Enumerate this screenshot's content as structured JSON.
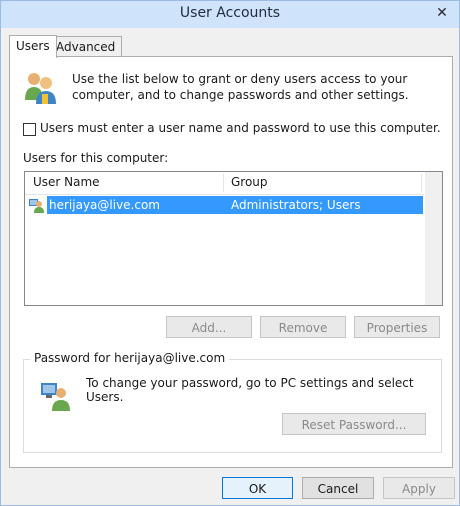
{
  "window": {
    "title": "User Accounts",
    "close_glyph": "✕"
  },
  "tabs": [
    {
      "label": "Users",
      "active": true
    },
    {
      "label": "Advanced",
      "active": false
    }
  ],
  "intro": {
    "icon": "users-icon",
    "text": "Use the list below to grant or deny users access to your computer, and to change passwords and other settings."
  },
  "require_login": {
    "label": "Users must enter a user name and password to use this computer.",
    "checked": false
  },
  "users_list": {
    "label": "Users for this computer:",
    "columns": [
      "User Name",
      "Group"
    ],
    "rows": [
      {
        "user": "herijaya@live.com",
        "group": "Administrators; Users",
        "selected": true
      }
    ]
  },
  "list_buttons": {
    "add": "Add...",
    "remove": "Remove",
    "properties": "Properties"
  },
  "password": {
    "group_title": "Password for herijaya@live.com",
    "text": "To change your password, go to PC settings and select Users.",
    "reset_button": "Reset Password..."
  },
  "footer": {
    "ok": "OK",
    "cancel": "Cancel",
    "apply": "Apply"
  },
  "colors": {
    "selection": "#3399ff",
    "titlebar": "#cfe3fb",
    "default_button_border": "#0078d7"
  }
}
